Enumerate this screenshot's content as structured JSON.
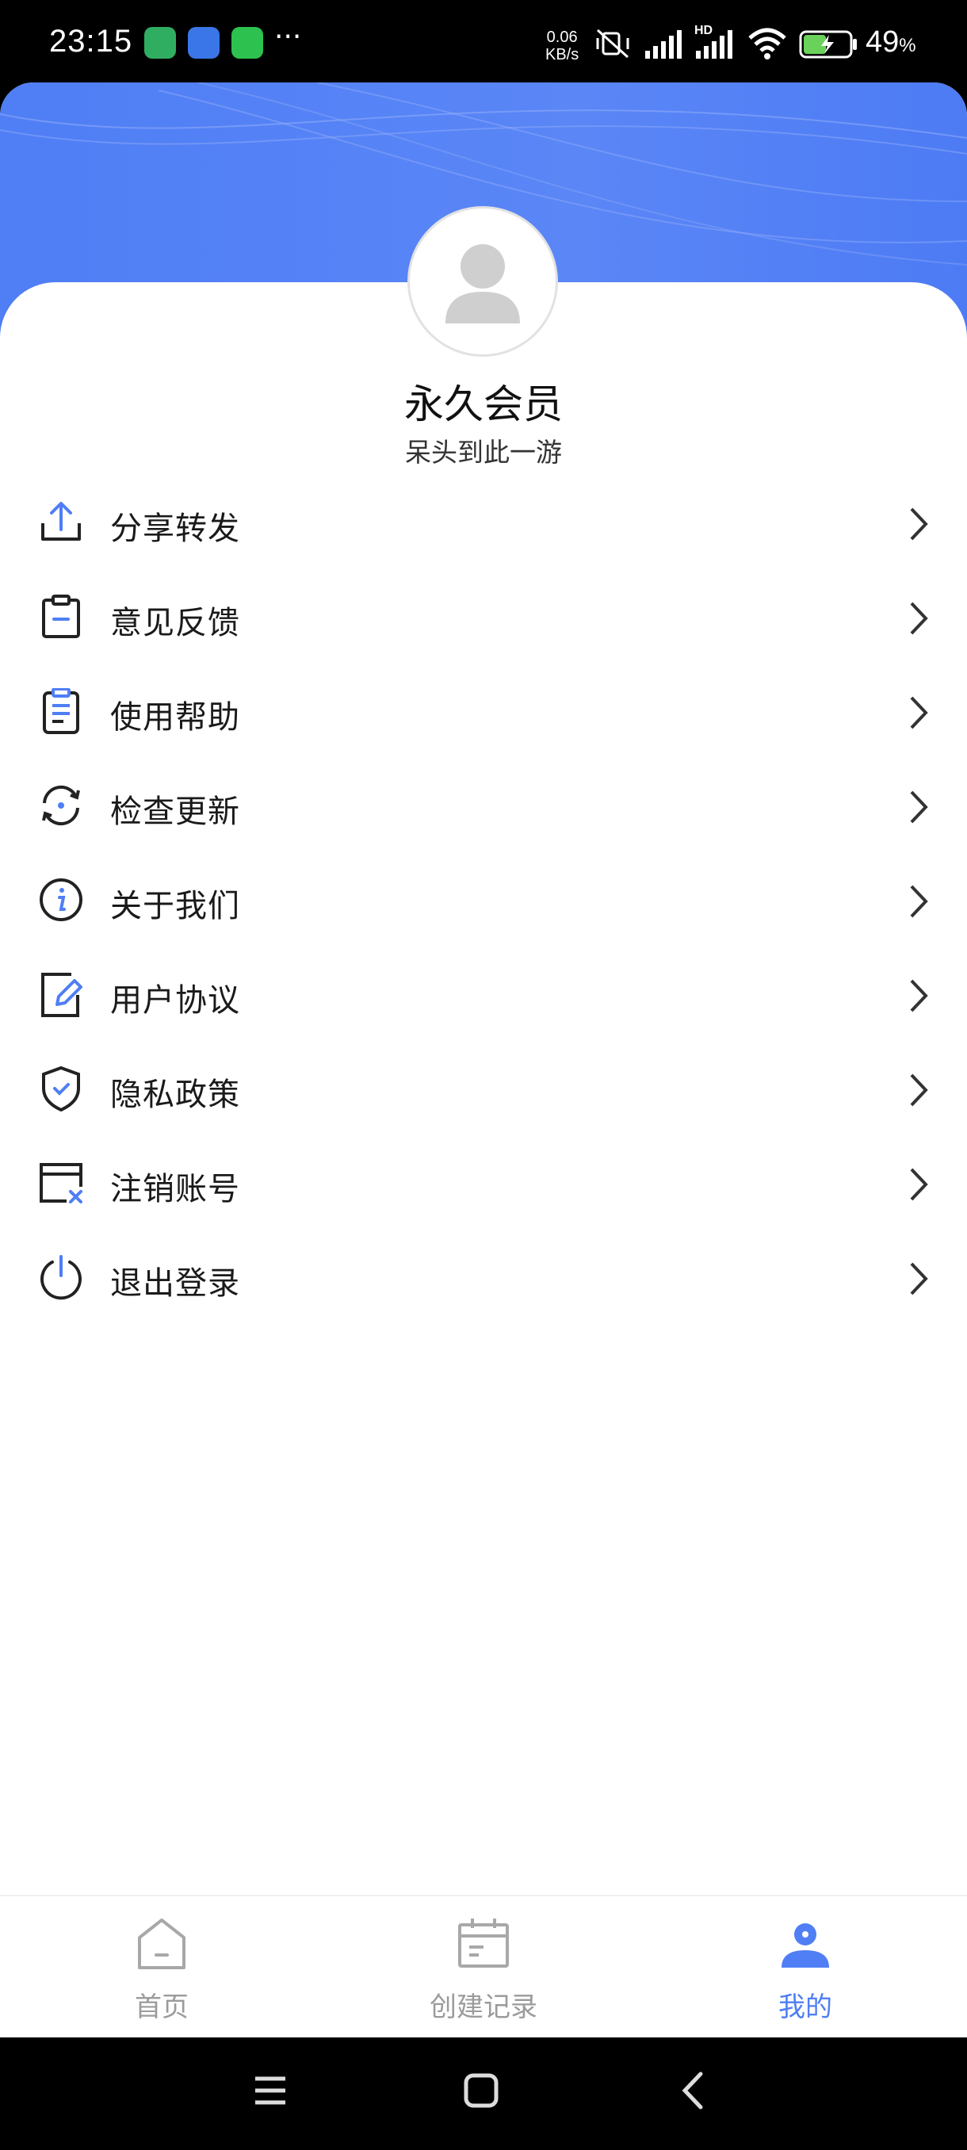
{
  "status_bar": {
    "time": "23:15",
    "net_speed_value": "0.06",
    "net_speed_unit": "KB/s",
    "signal_label": "HD",
    "battery_percent": "49",
    "battery_unit": "%"
  },
  "profile": {
    "name": "永久会员",
    "subtitle": "呆头到此一游"
  },
  "menu": {
    "items": [
      {
        "label": "分享转发",
        "icon": "share-upload-icon"
      },
      {
        "label": "意见反馈",
        "icon": "feedback-clipboard-icon"
      },
      {
        "label": "使用帮助",
        "icon": "help-document-icon"
      },
      {
        "label": "检查更新",
        "icon": "refresh-update-icon"
      },
      {
        "label": "关于我们",
        "icon": "info-circle-icon"
      },
      {
        "label": "用户协议",
        "icon": "edit-agreement-icon"
      },
      {
        "label": "隐私政策",
        "icon": "shield-check-icon"
      },
      {
        "label": "注销账号",
        "icon": "close-account-icon"
      },
      {
        "label": "退出登录",
        "icon": "power-icon"
      }
    ]
  },
  "tabbar": {
    "tabs": [
      {
        "label": "首页",
        "icon": "home-icon",
        "active": false
      },
      {
        "label": "创建记录",
        "icon": "calendar-icon",
        "active": false
      },
      {
        "label": "我的",
        "icon": "user-icon",
        "active": true
      }
    ]
  },
  "colors": {
    "accent": "#4f7ef5",
    "tab_inactive": "#9b9b9b",
    "text": "#1a1a1a"
  }
}
